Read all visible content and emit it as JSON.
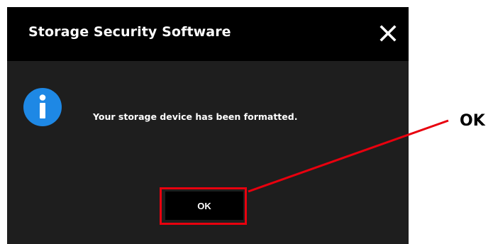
{
  "dialog": {
    "title": "Storage Security Software",
    "message": "Your storage device has been formatted.",
    "ok_label": "OK"
  },
  "icons": {
    "close": "close-icon",
    "info": "info-icon"
  },
  "annotation": {
    "callout_label": "OK",
    "highlight_color": "#e8000e"
  },
  "colors": {
    "titlebar": "#000000",
    "dialog_body": "#1e1e1e",
    "info_icon": "#1e88e5"
  }
}
